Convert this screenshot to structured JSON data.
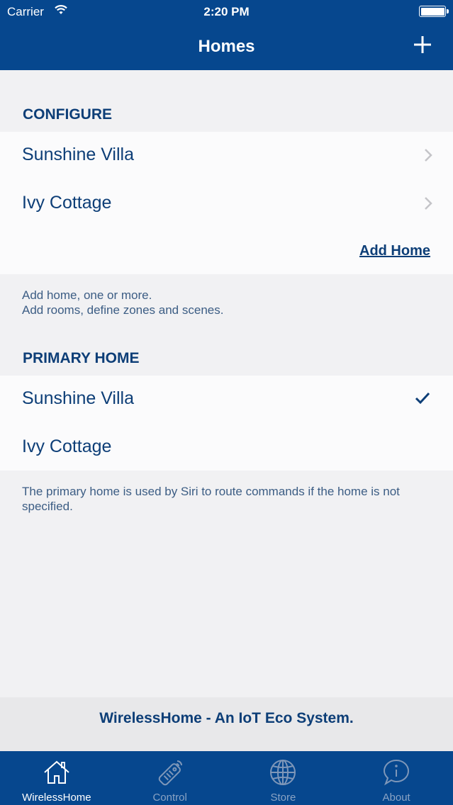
{
  "status_bar": {
    "carrier": "Carrier",
    "time": "2:20 PM"
  },
  "nav": {
    "title": "Homes",
    "add_icon": "plus-icon"
  },
  "configure": {
    "header": "CONFIGURE",
    "items": [
      {
        "label": "Sunshine Villa"
      },
      {
        "label": "Ivy Cottage"
      }
    ],
    "add_home_label": "Add Home",
    "footnote_line1": "Add home, one or more.",
    "footnote_line2": "Add rooms, define zones and scenes."
  },
  "primary_home": {
    "header": "PRIMARY HOME",
    "items": [
      {
        "label": "Sunshine Villa",
        "selected": true
      },
      {
        "label": "Ivy Cottage",
        "selected": false
      }
    ],
    "footnote": "The primary home is used by Siri to route commands if the home is not specified."
  },
  "footer": {
    "text": "WirelessHome - An IoT Eco System."
  },
  "tabbar": {
    "tabs": [
      {
        "label": "WirelessHome",
        "icon": "home-icon",
        "active": true
      },
      {
        "label": "Control",
        "icon": "remote-control-icon",
        "active": false
      },
      {
        "label": "Store",
        "icon": "globe-icon",
        "active": false
      },
      {
        "label": "About",
        "icon": "info-bubble-icon",
        "active": false
      }
    ]
  },
  "colors": {
    "brand_blue": "#06478e",
    "text_blue": "#0d3e77",
    "background": "#f1f1f3"
  }
}
